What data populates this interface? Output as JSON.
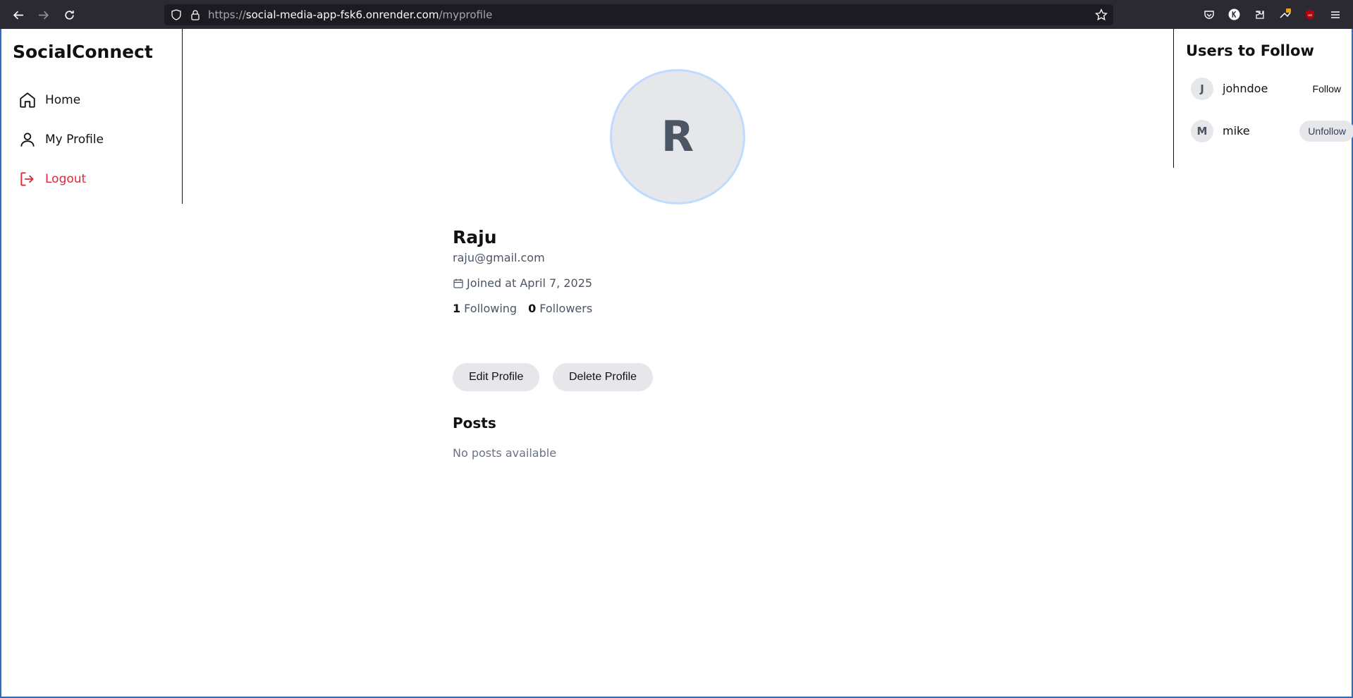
{
  "browser": {
    "url_scheme": "https://",
    "url_host": "social-media-app-fsk6.onrender.com",
    "url_path": "/myprofile",
    "icons": [
      "back-icon",
      "forward-icon",
      "reload-icon",
      "shield-icon",
      "lock-icon",
      "star-icon",
      "pocket-icon",
      "account-icon",
      "extensions-icon",
      "extension-badge-icon",
      "ublock-icon",
      "menu-icon"
    ]
  },
  "sidebar": {
    "brand": "SocialConnect",
    "items": [
      {
        "label": "Home",
        "icon": "home-icon"
      },
      {
        "label": "My Profile",
        "icon": "user-icon"
      },
      {
        "label": "Logout",
        "icon": "logout-icon"
      }
    ]
  },
  "suggestions": {
    "title": "Users to Follow",
    "users": [
      {
        "initial": "J",
        "name": "johndoe",
        "action": "Follow"
      },
      {
        "initial": "M",
        "name": "mike",
        "action": "Unfollow"
      }
    ]
  },
  "profile": {
    "avatar_initial": "R",
    "name": "Raju",
    "email": "raju@gmail.com",
    "joined": "Joined at April 7, 2025",
    "following_count": "1",
    "following_label": "Following",
    "followers_count": "0",
    "followers_label": "Followers",
    "edit_label": "Edit Profile",
    "delete_label": "Delete Profile"
  },
  "posts": {
    "title": "Posts",
    "empty_text": "No posts available"
  },
  "colors": {
    "logout": "#e0283a",
    "avatar_bg": "#e5e7eb",
    "avatar_ring": "#bfdbfe",
    "chrome_bg": "#2b2a33"
  }
}
